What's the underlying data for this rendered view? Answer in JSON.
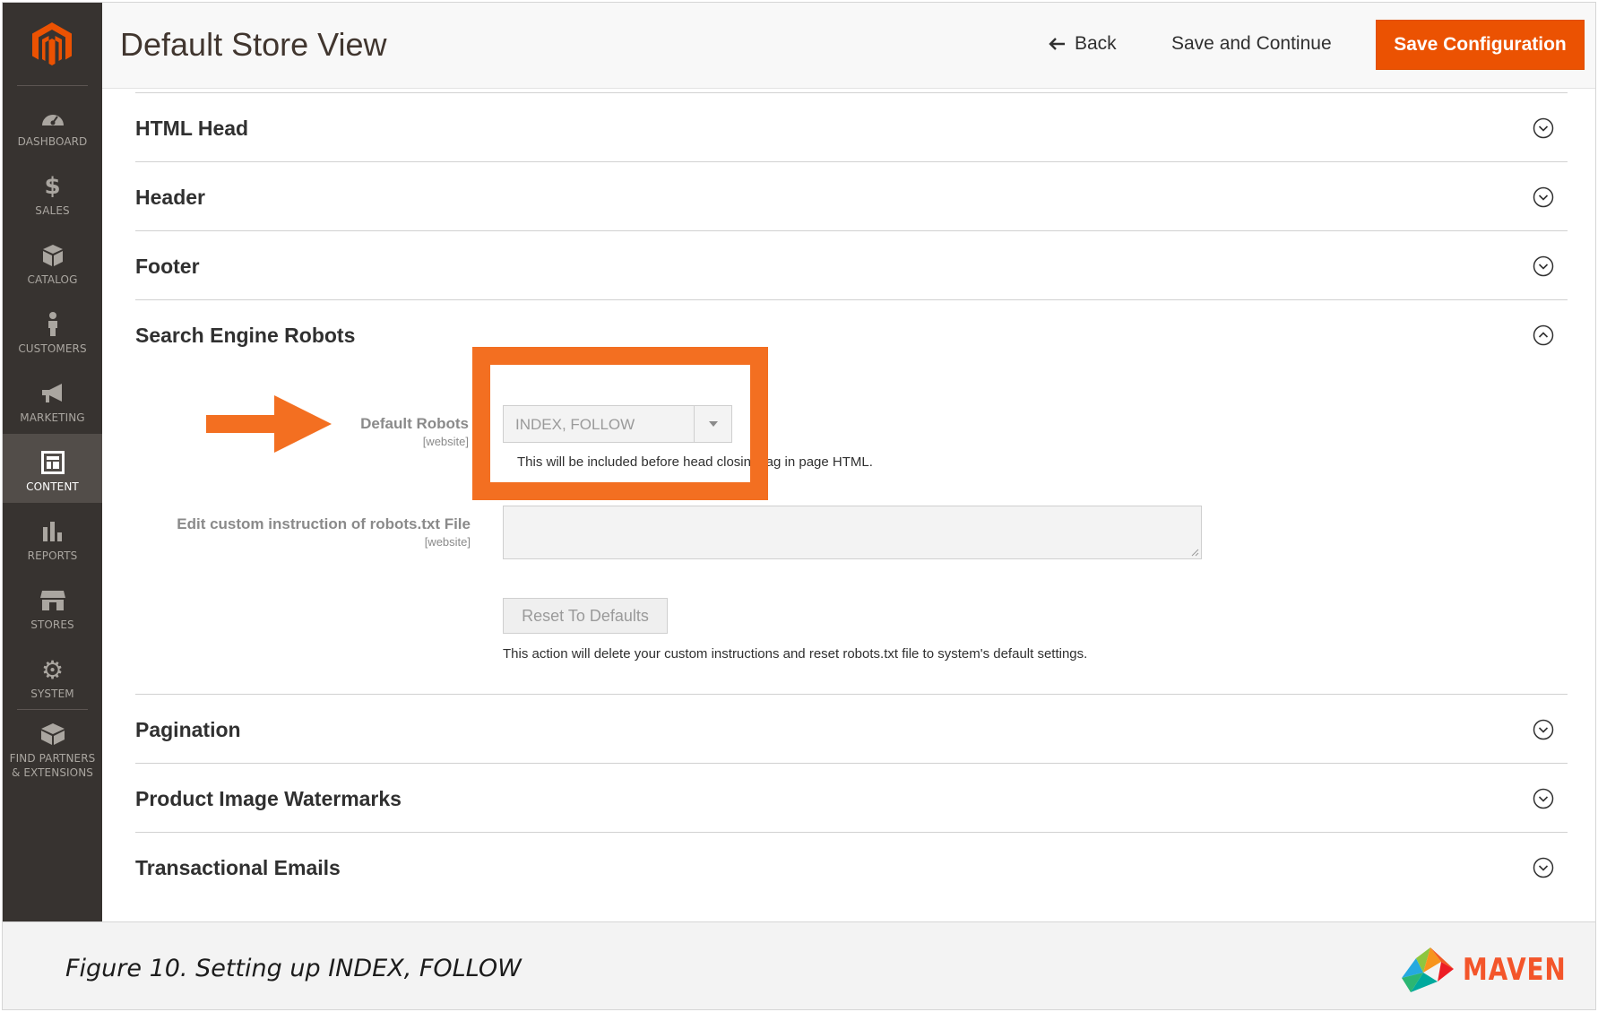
{
  "colors": {
    "accent": "#eb5202",
    "sidebar": "#373330",
    "highlight": "#f36f21"
  },
  "header": {
    "title": "Default Store View",
    "back_label": "Back",
    "save_continue_label": "Save and Continue",
    "save_config_label": "Save Configuration"
  },
  "sidebar": {
    "items": [
      {
        "label": "DASHBOARD",
        "icon": "dashboard-icon"
      },
      {
        "label": "SALES",
        "icon": "dollar-icon"
      },
      {
        "label": "CATALOG",
        "icon": "box-icon"
      },
      {
        "label": "CUSTOMERS",
        "icon": "person-icon"
      },
      {
        "label": "MARKETING",
        "icon": "megaphone-icon"
      },
      {
        "label": "CONTENT",
        "icon": "layout-icon",
        "active": true
      },
      {
        "label": "REPORTS",
        "icon": "bar-chart-icon"
      },
      {
        "label": "STORES",
        "icon": "storefront-icon"
      },
      {
        "label": "SYSTEM",
        "icon": "gear-icon"
      },
      {
        "label_line1": "FIND PARTNERS",
        "label_line2": "& EXTENSIONS",
        "icon": "blocks-icon"
      }
    ]
  },
  "sections": {
    "html_head": "HTML Head",
    "header": "Header",
    "footer": "Footer",
    "robots": "Search Engine Robots",
    "pagination": "Pagination",
    "watermarks": "Product Image Watermarks",
    "emails": "Transactional Emails"
  },
  "robots": {
    "default_robots_label": "Default Robots",
    "default_robots_scope": "[website]",
    "default_robots_value": "INDEX, FOLLOW",
    "default_robots_note": "This will be included before head closing tag in page HTML.",
    "custom_label": "Edit custom instruction of robots.txt File",
    "custom_scope": "[website]",
    "custom_value": "",
    "reset_label": "Reset To Defaults",
    "reset_note": "This action will delete your custom instructions and reset robots.txt file to system's default settings."
  },
  "caption": {
    "text": "Figure 10. Setting up INDEX, FOLLOW",
    "brand": "MAVEN"
  }
}
